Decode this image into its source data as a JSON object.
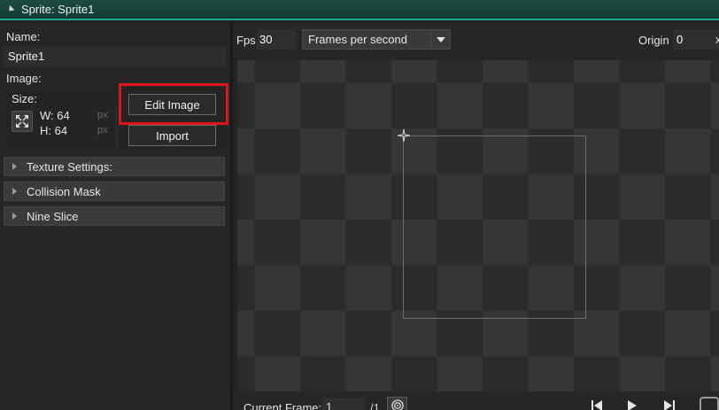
{
  "window": {
    "title": "Sprite: Sprite1"
  },
  "left_panel": {
    "name_label": "Name:",
    "name_value": "Sprite1",
    "image_label": "Image:",
    "size_label": "Size:",
    "width_text": "W: 64",
    "height_text": "H: 64",
    "unit": "px",
    "edit_image_label": "Edit Image",
    "import_label": "Import",
    "sections": [
      {
        "label": "Texture Settings:"
      },
      {
        "label": "Collision Mask"
      },
      {
        "label": "Nine Slice"
      }
    ]
  },
  "toolbar": {
    "fps_label": "Fps",
    "fps_value": "30",
    "fps_mode": "Frames per second",
    "origin_label": "Origin",
    "origin_value": "0",
    "origin_separator": "x"
  },
  "bottom_bar": {
    "current_frame_label": "Current Frame:",
    "current_frame_value": "1",
    "frame_total": "/1"
  },
  "colors": {
    "title_accent": "#1fa88a",
    "highlight_box": "#e0141b"
  }
}
